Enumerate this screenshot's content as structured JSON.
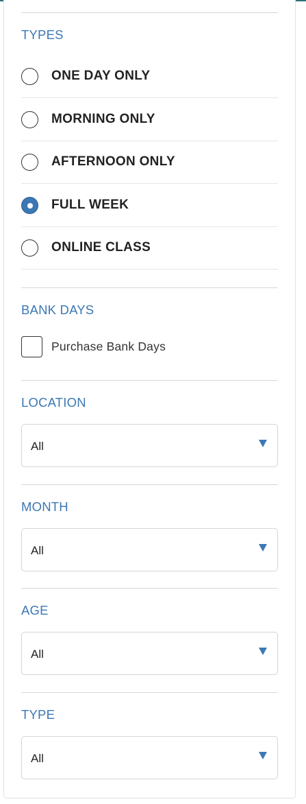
{
  "filters": {
    "types": {
      "title": "TYPES",
      "options": [
        {
          "label": "ONE DAY ONLY",
          "checked": false
        },
        {
          "label": "MORNING ONLY",
          "checked": false
        },
        {
          "label": "AFTERNOON ONLY",
          "checked": false
        },
        {
          "label": "FULL WEEK",
          "checked": true
        },
        {
          "label": "ONLINE CLASS",
          "checked": false
        }
      ]
    },
    "bank_days": {
      "title": "BANK DAYS",
      "checkbox_label": "Purchase Bank Days",
      "checked": false
    },
    "location": {
      "title": "LOCATION",
      "value": "All"
    },
    "month": {
      "title": "MONTH",
      "value": "All"
    },
    "age": {
      "title": "AGE",
      "value": "All"
    },
    "type": {
      "title": "TYPE",
      "value": "All"
    }
  },
  "colors": {
    "accent": "#3c78b4",
    "divider": "#d7d7d7",
    "text": "#222222"
  },
  "icons": {
    "radio_checked": "radio-checked-icon",
    "radio_unchecked": "radio-unchecked-icon",
    "dropdown": "triangle-down-icon"
  }
}
